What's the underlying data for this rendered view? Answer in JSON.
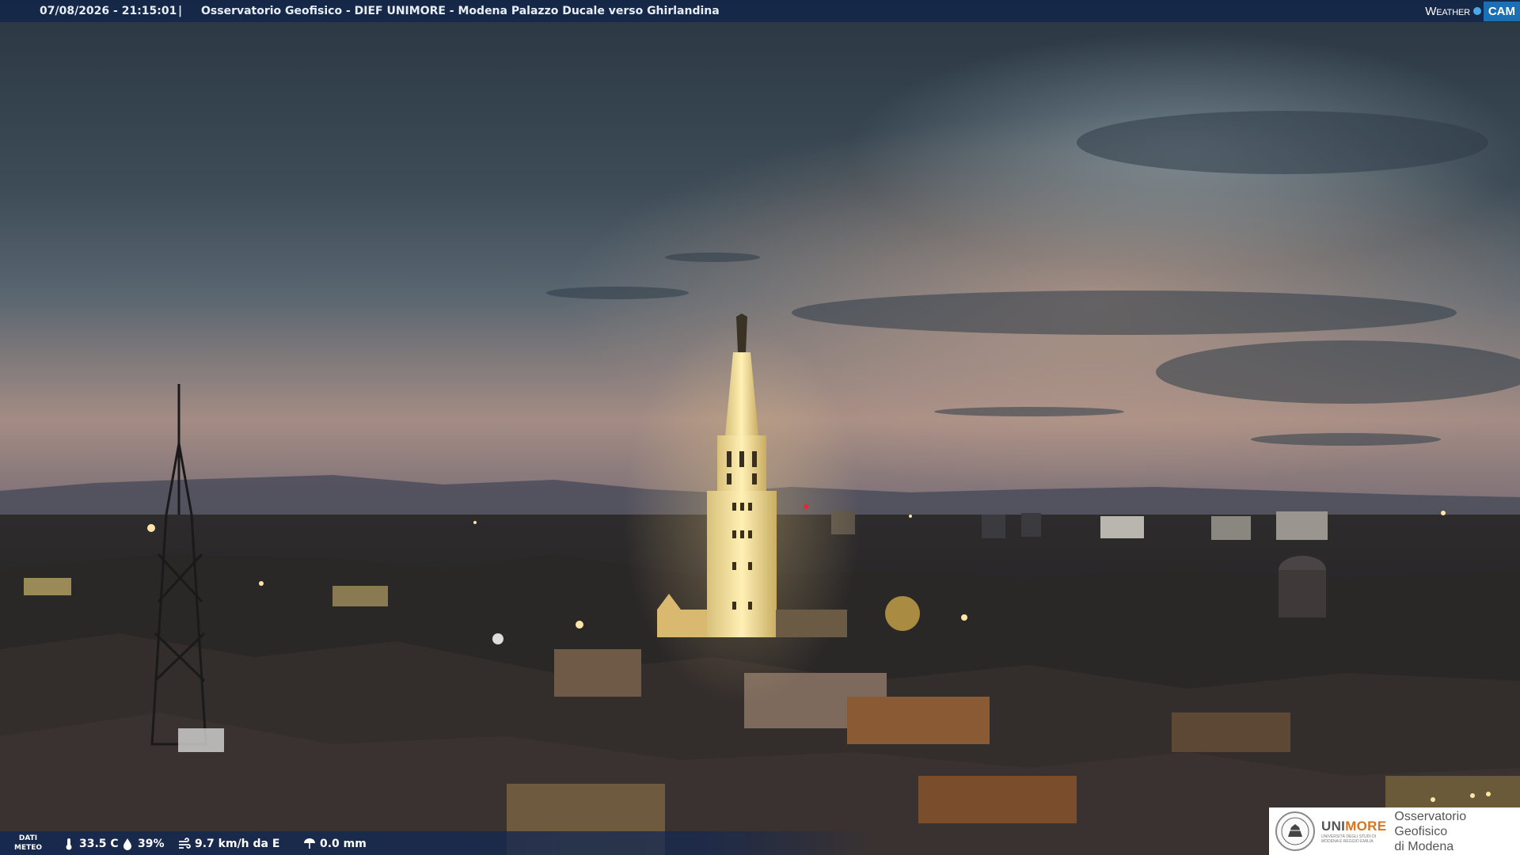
{
  "header": {
    "datetime": "07/08/2026 - 21:15:01",
    "separator": "|",
    "title": "Osservatorio Geofisico - DIEF UNIMORE - Modena Palazzo Ducale verso Ghirlandina"
  },
  "brand": {
    "weather": "Weather",
    "cam": "CAM"
  },
  "weather_data": {
    "label_line1": "DATI",
    "label_line2": "METEO",
    "temperature": "33.5 C",
    "humidity": "39%",
    "wind": "9.7 km/h da E",
    "rain": "0.0 mm"
  },
  "logo": {
    "uni_prefix": "UNI",
    "uni_suffix": "MORE",
    "uni_sub": "UNIVERSITÀ DEGLI STUDI DI MODENA E REGGIO EMILIA",
    "observatory_line1": "Osservatorio Geofisico",
    "observatory_line2": "di Modena"
  },
  "colors": {
    "sky_top": "#2b3a47",
    "sky_horizon": "#c49a86",
    "tower_light": "#f5e3a0",
    "bar_bg": "#122648",
    "accent_orange": "#d8731e"
  },
  "icons": [
    "thermometer-icon",
    "droplet-icon",
    "wind-icon",
    "rain-gauge-icon"
  ]
}
